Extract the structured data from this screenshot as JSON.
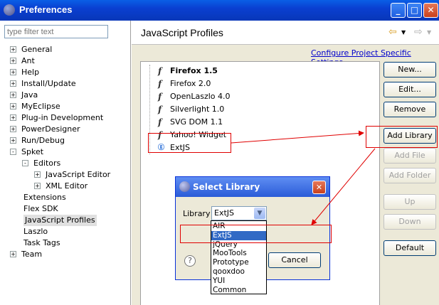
{
  "window": {
    "title": "Preferences",
    "controls": [
      "minimize-icon",
      "maximize-icon",
      "close-icon"
    ]
  },
  "sidebar": {
    "filter_placeholder": "type filter text",
    "items": [
      {
        "label": "General",
        "expander": "+"
      },
      {
        "label": "Ant",
        "expander": "+"
      },
      {
        "label": "Help",
        "expander": "+"
      },
      {
        "label": "Install/Update",
        "expander": "+"
      },
      {
        "label": "Java",
        "expander": "+"
      },
      {
        "label": "MyEclipse",
        "expander": "+"
      },
      {
        "label": "Plug-in Development",
        "expander": "+"
      },
      {
        "label": "PowerDesigner",
        "expander": "+"
      },
      {
        "label": "Run/Debug",
        "expander": "+"
      },
      {
        "label": "Spket",
        "expander": "-"
      },
      {
        "label": "Editors",
        "expander": "-"
      },
      {
        "label": "JavaScript Editor",
        "expander": "+"
      },
      {
        "label": "XML Editor",
        "expander": "+"
      },
      {
        "label": "Extensions",
        "expander": ""
      },
      {
        "label": "Flex SDK",
        "expander": ""
      },
      {
        "label": "JavaScript Profiles",
        "expander": "",
        "selected": true
      },
      {
        "label": "Laszlo",
        "expander": ""
      },
      {
        "label": "Task Tags",
        "expander": ""
      },
      {
        "label": "Team",
        "expander": "+"
      }
    ]
  },
  "page": {
    "title": "JavaScript Profiles",
    "configure_link": "Configure Project Specific Settings...",
    "nav": {
      "back_icon": "back-arrow-icon",
      "forward_icon": "forward-arrow-icon"
    }
  },
  "profiles": [
    {
      "label": "Firefox 1.5",
      "icon": "f0",
      "bold": true
    },
    {
      "label": "Firefox 2.0",
      "icon": "f0"
    },
    {
      "label": "OpenLaszlo 4.0",
      "icon": "f0"
    },
    {
      "label": "Silverlight 1.0",
      "icon": "f0"
    },
    {
      "label": "SVG DOM 1.1",
      "icon": "f0"
    },
    {
      "label": "Yahoo! Widget",
      "icon": "f0"
    },
    {
      "label": "ExtJS",
      "icon": "G"
    }
  ],
  "buttons": {
    "new": "New...",
    "edit": "Edit...",
    "remove": "Remove",
    "add_library": "Add Library",
    "add_file": "Add File",
    "add_folder": "Add Folder",
    "up": "Up",
    "down": "Down",
    "default": "Default"
  },
  "dialog": {
    "title": "Select Library",
    "library_label": "Library",
    "selected": "ExtJS",
    "cancel": "Cancel",
    "options": [
      "AIR",
      "ExtJS",
      "jQuery",
      "MooTools",
      "Prototype",
      "qooxdoo",
      "YUI",
      "Common"
    ]
  },
  "colors": {
    "titlebar": "#0a46d6",
    "selection": "#316ac5",
    "annotation": "#e00000",
    "link": "#0000cc"
  }
}
